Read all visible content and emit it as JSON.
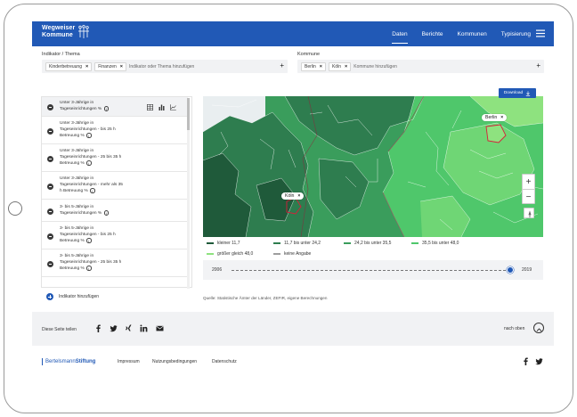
{
  "header": {
    "logo_line1": "Wegweiser",
    "logo_line2": "Kommune",
    "nav": [
      "Daten",
      "Berichte",
      "Kommunen",
      "Typisierung"
    ],
    "active_nav": "Daten"
  },
  "filters": {
    "indicator_label": "Indikator / Thema",
    "indicator_chips": [
      "Kinderbetreuung",
      "Finanzen"
    ],
    "indicator_placeholder": "Indikator oder Thema hinzufügen",
    "municipality_label": "Kommune",
    "municipality_chips": [
      "Berlin",
      "Köln"
    ],
    "municipality_placeholder": "Kommune hinzufügen"
  },
  "indicators": [
    {
      "lines": [
        "Unter 3-Jährige in",
        "Tageseinrichtungen %"
      ]
    },
    {
      "lines": [
        "Unter 3-Jährige in",
        "Tageseinrichtungen - bis 25 h",
        "Betreuung %"
      ]
    },
    {
      "lines": [
        "Unter 3-Jährige in",
        "Tageseinrichtungen - 25 bis 35 h",
        "Betreuung %"
      ]
    },
    {
      "lines": [
        "Unter 3-Jährige in",
        "Tageseinrichtungen - mehr als 35",
        "h Betreuung %"
      ]
    },
    {
      "lines": [
        "3- bis 5-Jährige in",
        "Tageseinrichtungen %"
      ]
    },
    {
      "lines": [
        "3- bis 5-Jährige in",
        "Tageseinrichtungen - bis 25 h",
        "Betreuung %"
      ]
    },
    {
      "lines": [
        "3- bis 5-Jährige in",
        "Tageseinrichtungen - 25 bis 35 h",
        "Betreuung %"
      ]
    }
  ],
  "add_indicator": "Indikator hinzufügen",
  "map": {
    "download": "Download",
    "city_berlin": "Berlin",
    "city_koeln": "Köln",
    "zoom_in": "+",
    "zoom_out": "−"
  },
  "legend": [
    {
      "label": "kleiner 11,7",
      "color": "#1f5a3a"
    },
    {
      "label": "11,7 bis unter 24,2",
      "color": "#2e7d4f"
    },
    {
      "label": "24,2 bis unter 35,5",
      "color": "#3a9d5c"
    },
    {
      "label": "35,5 bis unter 48,0",
      "color": "#4fc76b"
    },
    {
      "label": "größer gleich 48,0",
      "color": "#8ee27f"
    },
    {
      "label": "keine Angabe",
      "color": "#9e9e9e"
    }
  ],
  "timeline": {
    "start": "2006",
    "end": "2019",
    "value": 1.0
  },
  "source": "Quelle: Statistische Ämter der Länder, ZEFIR, eigene Berechnungen",
  "share": {
    "label": "Diese Seite teilen",
    "top_link": "nach oben"
  },
  "footer": {
    "logo_part1": "Bertelsmann",
    "logo_part2": "Stiftung",
    "links": [
      "Impressum",
      "Nutzungsbedingungen",
      "Datenschutz"
    ]
  },
  "icons": {
    "social": [
      "facebook-icon",
      "twitter-icon",
      "xing-icon",
      "linkedin-icon",
      "mail-icon"
    ],
    "footer_social": [
      "facebook-icon",
      "twitter-icon"
    ]
  }
}
